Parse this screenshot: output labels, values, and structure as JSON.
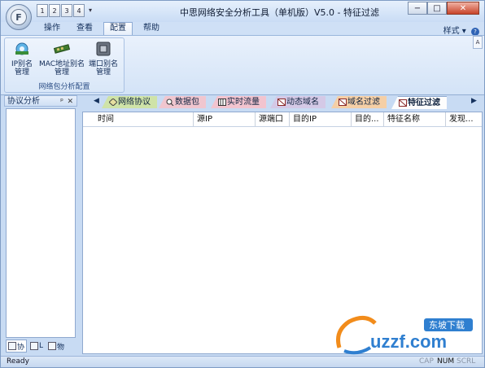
{
  "app": {
    "title": "中思网络安全分析工具（单机版）V5.0 - 特征过滤",
    "orb_letter": "F",
    "qat": [
      "1",
      "2",
      "3",
      "4"
    ],
    "window_buttons": {
      "minimize": "−",
      "maximize": "□",
      "close": "✕"
    }
  },
  "menu": {
    "tabs": [
      "操作",
      "查看",
      "配置",
      "帮助"
    ],
    "active": "配置",
    "style_label": "样式 ▾",
    "help_glyph": "?"
  },
  "ribbon": {
    "group_label": "网络包分析配置",
    "buttons": [
      {
        "line1": "IP别名",
        "line2": "管理",
        "icon": "ip-alias-icon"
      },
      {
        "line1": "MAC地址别名",
        "line2": "管理",
        "icon": "mac-alias-icon"
      },
      {
        "line1": "端口别名",
        "line2": "管理",
        "icon": "port-alias-icon"
      }
    ],
    "collapse_glyph": "A"
  },
  "left_panel": {
    "title": "协议分析",
    "pin_glyph": "ᵖ",
    "close_glyph": "✕",
    "tabs": [
      "协",
      "L",
      "物"
    ]
  },
  "content_tabs": {
    "nav_left": "◀",
    "nav_right": "▶",
    "items": [
      {
        "label": "网络协议",
        "color": "#cfe3a8"
      },
      {
        "label": "数据包",
        "color": "#f0c6cf"
      },
      {
        "label": "实时流量",
        "color": "#f2c4cf"
      },
      {
        "label": "动态域名",
        "color": "#d4c9e6"
      },
      {
        "label": "域名过滤",
        "color": "#f5cfa6"
      },
      {
        "label": "特征过滤",
        "color": "#ffffff"
      }
    ]
  },
  "table": {
    "columns": [
      "时间",
      "源IP",
      "源端口",
      "目的IP",
      "目的...",
      "特征名称",
      "发现..."
    ]
  },
  "watermark": {
    "brand": "uzzf.com",
    "badge": "东坡下载"
  },
  "status": {
    "text": "Ready",
    "indicators": [
      "CAP",
      "NUM",
      "SCRL"
    ]
  }
}
